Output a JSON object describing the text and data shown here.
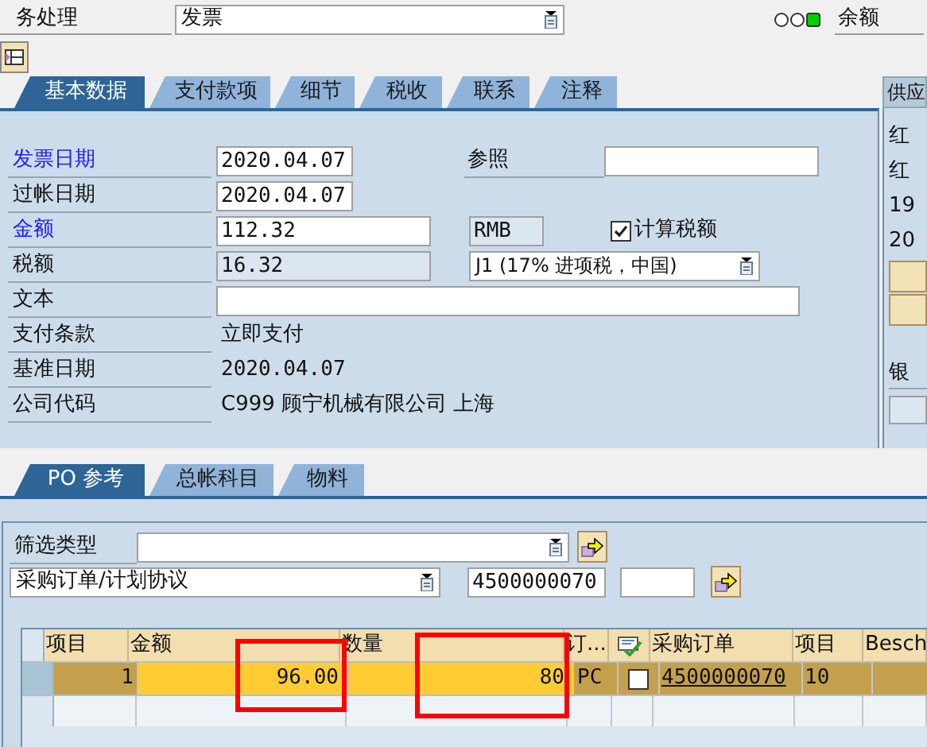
{
  "header": {
    "transaction_label": "务处理",
    "transaction_type": "发票",
    "status_lights": [
      {
        "on": false
      },
      {
        "on": false
      },
      {
        "on": true
      }
    ],
    "balance_label": "余额"
  },
  "tabs": [
    {
      "label": "基本数据",
      "selected": true
    },
    {
      "label": "支付款项",
      "selected": false
    },
    {
      "label": "细节",
      "selected": false
    },
    {
      "label": "税收",
      "selected": false
    },
    {
      "label": "联系",
      "selected": false
    },
    {
      "label": "注释",
      "selected": false
    }
  ],
  "basic_data": {
    "rows": [
      {
        "kind": "input",
        "label": "发票日期",
        "required": true,
        "value": "2020.04.07"
      },
      {
        "kind": "input",
        "label": "过帐日期",
        "required": false,
        "value": "2020.04.07"
      },
      {
        "kind": "input",
        "label": "金额",
        "required": true,
        "value": "112.32"
      },
      {
        "kind": "readonly",
        "label": "税额",
        "required": false,
        "value": "16.32"
      },
      {
        "kind": "input",
        "label": "文本",
        "required": false
      },
      {
        "kind": "text",
        "label": "支付条款",
        "required": false,
        "value": "立即支付"
      },
      {
        "kind": "text",
        "label": "基准日期",
        "required": false,
        "value": "2020.04.07"
      },
      {
        "kind": "text",
        "label": "公司代码",
        "required": false,
        "value": "C999 顾宁机械有限公司 上海"
      }
    ],
    "reference": {
      "label": "参照"
    },
    "currency": "RMB",
    "calculate_tax": {
      "label": "计算税额",
      "checked": true
    },
    "tax_code": "J1 (17% 进项税，中国)"
  },
  "side_panel": {
    "header": "供应",
    "lines": [
      "红",
      "红",
      "19",
      "20"
    ],
    "bank_label": "银"
  },
  "po_tabs": [
    {
      "label": "PO 参考",
      "selected": true
    },
    {
      "label": "总帐科目",
      "selected": false
    },
    {
      "label": "物料",
      "selected": false
    }
  ],
  "po_reference": {
    "filter_label": "筛选类型",
    "document_type": "采购订单/计划协议",
    "po_number": "4500000070",
    "table": {
      "columns": [
        {
          "kind": "text",
          "label": "项目"
        },
        {
          "kind": "text",
          "label": "金额"
        },
        {
          "kind": "text",
          "label": "数量"
        },
        {
          "kind": "text",
          "label": "订..."
        },
        {
          "kind": "icon"
        },
        {
          "kind": "text",
          "label": "采购订单"
        },
        {
          "kind": "text",
          "label": "项目"
        },
        {
          "kind": "text",
          "label": "Besch"
        }
      ],
      "rows": [
        {
          "selected": true,
          "item": "1",
          "amount": "96.00",
          "quantity": "80",
          "unit": "PC",
          "checked": false,
          "po": "4500000070",
          "po_item": "10"
        }
      ]
    }
  }
}
